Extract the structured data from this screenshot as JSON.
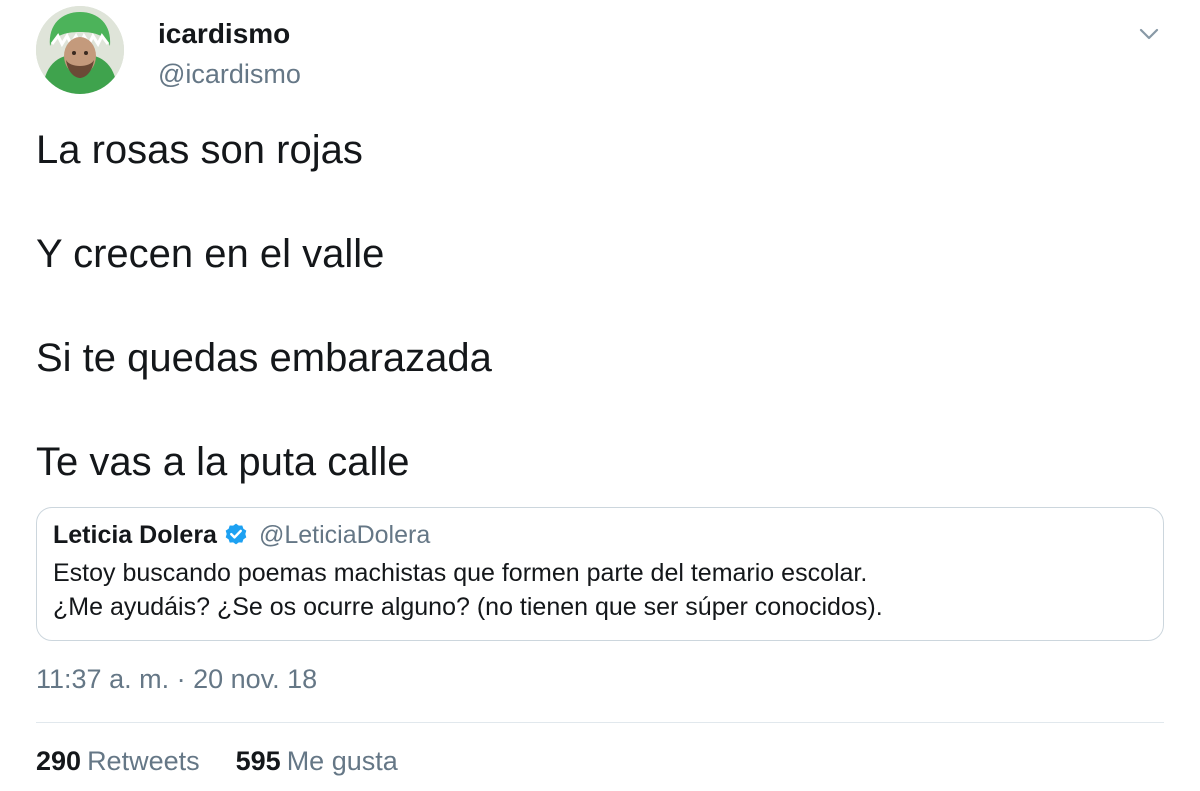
{
  "author": {
    "display_name": "icardismo",
    "handle": "@icardismo"
  },
  "tweet": {
    "lines": [
      "La rosas son rojas",
      "Y crecen en el valle",
      "Si te quedas embarazada",
      "Te vas a la puta calle"
    ]
  },
  "quoted_tweet": {
    "display_name": "Leticia Dolera",
    "handle": "@LeticiaDolera",
    "body_lines": [
      "Estoy buscando poemas machistas que formen parte del temario escolar.",
      "¿Me ayudáis? ¿Se os ocurre alguno? (no tienen que ser súper conocidos)."
    ],
    "verified_icon": "verified-badge-icon"
  },
  "timestamp": "11:37 a. m. · 20 nov. 18",
  "stats": {
    "retweets_count": "290",
    "retweets_label": "Retweets",
    "likes_count": "595",
    "likes_label": "Me gusta"
  },
  "colors": {
    "text_primary": "#14171a",
    "text_secondary": "#657786",
    "border": "#ccd6dd",
    "verified_blue": "#1da1f2"
  }
}
